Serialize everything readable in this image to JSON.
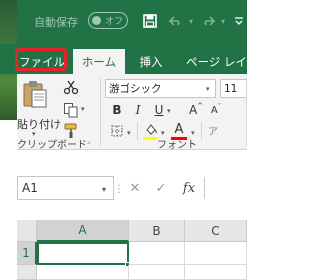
{
  "titlebar": {
    "autosave_label": "自動保存",
    "autosave_toggle": "オフ",
    "save_icon": "save-icon",
    "undo_icon": "undo-icon",
    "redo_icon": "redo-icon",
    "qat_more_icon": "customize-quick-access-icon",
    "colors": {
      "bar": "#217346",
      "dim_text": "#9fc9ae"
    }
  },
  "tabs": [
    {
      "label": "ファイル",
      "state": "highlighted"
    },
    {
      "label": "ホーム",
      "state": "active"
    },
    {
      "label": "挿入",
      "state": "normal"
    },
    {
      "label": "ページ レイア",
      "state": "normal"
    }
  ],
  "highlight_color": "#e8242a",
  "ribbon": {
    "clipboard": {
      "paste_label": "貼り付け",
      "group_label": "クリップボード",
      "cut_icon": "scissors-icon",
      "copy_icon": "copy-icon",
      "format_painter_icon": "format-painter-icon"
    },
    "font": {
      "font_name": "游ゴシック",
      "font_size": "11",
      "bold": "B",
      "italic": "I",
      "underline": "U",
      "group_label": "フォント",
      "fill_color": "#ffff00",
      "font_color": "#ff0000",
      "font_color_letter": "A",
      "increase_size_letter": "A",
      "decrease_size_letter": "A"
    }
  },
  "formula_bar": {
    "name_box": "A1",
    "cancel_icon": "cancel-x-icon",
    "enter_icon": "checkmark-icon",
    "fx_label": "fx",
    "value": ""
  },
  "grid": {
    "columns": [
      "A",
      "B",
      "C"
    ],
    "rows": [
      "1"
    ],
    "active_cell": "A1"
  }
}
